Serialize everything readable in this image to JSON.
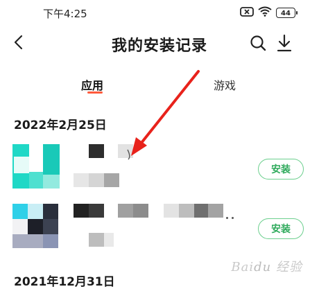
{
  "status_bar": {
    "time": "下午4:25",
    "battery": "44"
  },
  "nav": {
    "title": "我的安装记录",
    "back_icon": "chevron-left-icon",
    "search_icon": "search-icon",
    "download_icon": "download-icon"
  },
  "tabs": [
    {
      "label": "应用",
      "active": true
    },
    {
      "label": "游戏",
      "active": false
    }
  ],
  "sections": [
    {
      "date": "2022年2月25日",
      "items": [
        {
          "install_label": "安装"
        },
        {
          "install_label": "安装"
        }
      ]
    },
    {
      "date": "2021年12月31日"
    }
  ],
  "colors": {
    "accent_tab": "#ff5a3c",
    "install_green": "#2faa5c",
    "install_border": "#6ccf8e",
    "arrow_red": "#e8221b"
  },
  "watermark": "Baidu 经验"
}
